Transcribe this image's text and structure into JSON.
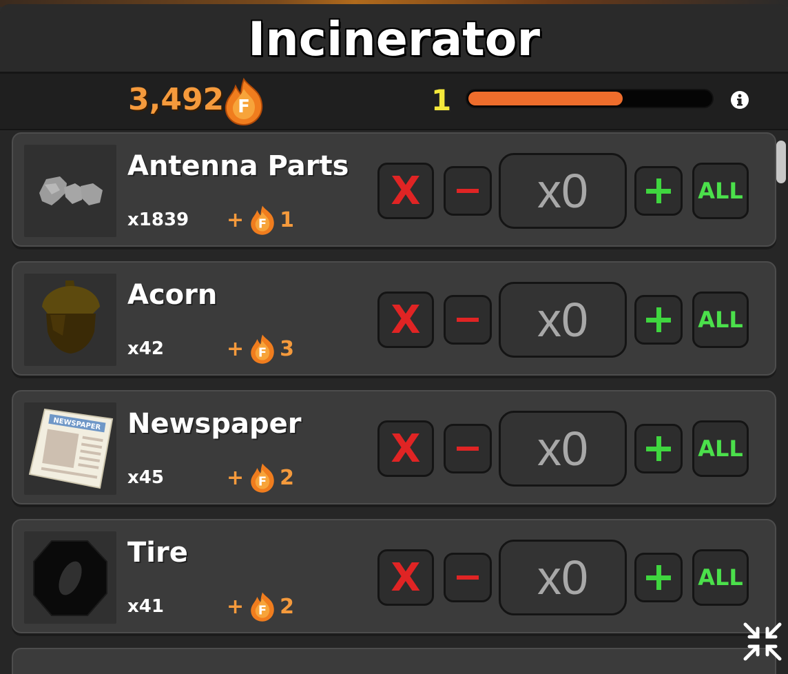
{
  "window": {
    "title": "Incinerator"
  },
  "stats": {
    "fuel": "3,492",
    "fuel_icon": "fuel-flame-icon",
    "level": "1",
    "level_progress": 0.64
  },
  "columns": {
    "remove_label": "X",
    "all_label": "ALL"
  },
  "items": [
    {
      "name": "Antenna Parts",
      "count": "x1839",
      "reward_plus": "+",
      "reward": "1",
      "qty": "x0",
      "icon": "antenna-parts-icon"
    },
    {
      "name": "Acorn",
      "count": "x42",
      "reward_plus": "+",
      "reward": "3",
      "qty": "x0",
      "icon": "acorn-icon"
    },
    {
      "name": "Newspaper",
      "count": "x45",
      "reward_plus": "+",
      "reward": "2",
      "qty": "x0",
      "icon": "newspaper-icon",
      "icon_text": "NEWSPAPER"
    },
    {
      "name": "Tire",
      "count": "x41",
      "reward_plus": "+",
      "reward": "2",
      "qty": "x0",
      "icon": "tire-icon"
    }
  ],
  "colors": {
    "fuel": "#f59a3c",
    "level": "#f5e93b",
    "progress": "#ee6d2c",
    "remove": "#e02424",
    "add": "#3fd63f"
  }
}
